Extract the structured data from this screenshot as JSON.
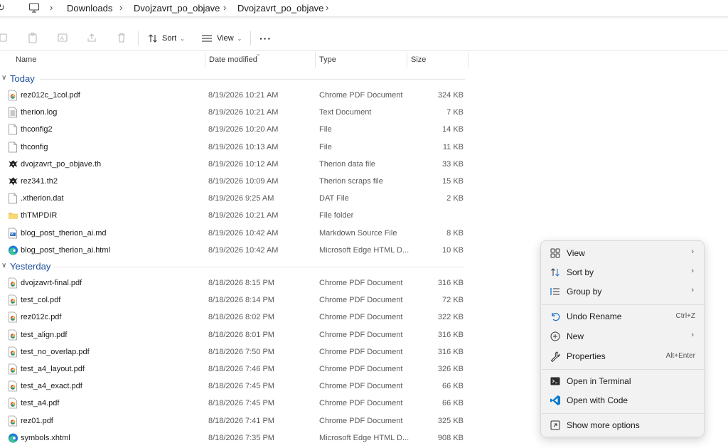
{
  "breadcrumb": {
    "items": [
      "Downloads",
      "Dvojzavrt_po_objave",
      "Dvojzavrt_po_objave"
    ]
  },
  "toolbar": {
    "sort_label": "Sort",
    "view_label": "View",
    "more_label": "···"
  },
  "columns": {
    "name": "Name",
    "date": "Date modified",
    "type": "Type",
    "size": "Size"
  },
  "groups": {
    "today": "Today",
    "yesterday": "Yesterday"
  },
  "today_files": [
    {
      "name": "rez012c_1col.pdf",
      "date": "8/19/2026 10:21 AM",
      "type": "Chrome PDF Document",
      "size": "324 KB",
      "icon": "pdf-icon"
    },
    {
      "name": "therion.log",
      "date": "8/19/2026 10:21 AM",
      "type": "Text Document",
      "size": "7 KB",
      "icon": "text-file-icon"
    },
    {
      "name": "thconfig2",
      "date": "8/19/2026 10:20 AM",
      "type": "File",
      "size": "14 KB",
      "icon": "file-icon"
    },
    {
      "name": "thconfig",
      "date": "8/19/2026 10:13 AM",
      "type": "File",
      "size": "11 KB",
      "icon": "file-icon"
    },
    {
      "name": "dvojzavrt_po_objave.th",
      "date": "8/19/2026 10:12 AM",
      "type": "Therion data file",
      "size": "33 KB",
      "icon": "therion-icon"
    },
    {
      "name": "rez341.th2",
      "date": "8/19/2026 10:09 AM",
      "type": "Therion scraps file",
      "size": "15 KB",
      "icon": "therion-icon"
    },
    {
      "name": ".xtherion.dat",
      "date": "8/19/2026 9:25 AM",
      "type": "DAT File",
      "size": "2 KB",
      "icon": "file-icon"
    },
    {
      "name": "thTMPDIR",
      "date": "8/19/2026 10:21 AM",
      "type": "File folder",
      "size": "",
      "icon": "folder-icon"
    },
    {
      "name": "blog_post_therion_ai.md",
      "date": "8/19/2026 10:42 AM",
      "type": "Markdown Source File",
      "size": "8 KB",
      "icon": "markdown-icon"
    },
    {
      "name": "blog_post_therion_ai.html",
      "date": "8/19/2026 10:42 AM",
      "type": "Microsoft Edge HTML D...",
      "size": "10 KB",
      "icon": "edge-icon"
    }
  ],
  "yesterday_files": [
    {
      "name": "dvojzavrt-final.pdf",
      "date": "8/18/2026 8:15 PM",
      "type": "Chrome PDF Document",
      "size": "316 KB",
      "icon": "pdf-icon"
    },
    {
      "name": "test_col.pdf",
      "date": "8/18/2026 8:14 PM",
      "type": "Chrome PDF Document",
      "size": "72 KB",
      "icon": "pdf-icon"
    },
    {
      "name": "rez012c.pdf",
      "date": "8/18/2026 8:02 PM",
      "type": "Chrome PDF Document",
      "size": "322 KB",
      "icon": "pdf-icon"
    },
    {
      "name": "test_align.pdf",
      "date": "8/18/2026 8:01 PM",
      "type": "Chrome PDF Document",
      "size": "316 KB",
      "icon": "pdf-icon"
    },
    {
      "name": "test_no_overlap.pdf",
      "date": "8/18/2026 7:50 PM",
      "type": "Chrome PDF Document",
      "size": "316 KB",
      "icon": "pdf-icon"
    },
    {
      "name": "test_a4_layout.pdf",
      "date": "8/18/2026 7:46 PM",
      "type": "Chrome PDF Document",
      "size": "326 KB",
      "icon": "pdf-icon"
    },
    {
      "name": "test_a4_exact.pdf",
      "date": "8/18/2026 7:45 PM",
      "type": "Chrome PDF Document",
      "size": "66 KB",
      "icon": "pdf-icon"
    },
    {
      "name": "test_a4.pdf",
      "date": "8/18/2026 7:45 PM",
      "type": "Chrome PDF Document",
      "size": "66 KB",
      "icon": "pdf-icon"
    },
    {
      "name": "rez01.pdf",
      "date": "8/18/2026 7:41 PM",
      "type": "Chrome PDF Document",
      "size": "325 KB",
      "icon": "pdf-icon"
    },
    {
      "name": "symbols.xhtml",
      "date": "8/18/2026 7:35 PM",
      "type": "Microsoft Edge HTML D...",
      "size": "908 KB",
      "icon": "edge-icon"
    }
  ],
  "context_menu": {
    "view": "View",
    "sort_by": "Sort by",
    "group_by": "Group by",
    "undo_rename": "Undo Rename",
    "undo_rename_key": "Ctrl+Z",
    "new": "New",
    "properties": "Properties",
    "properties_key": "Alt+Enter",
    "open_terminal": "Open in Terminal",
    "open_code": "Open with Code",
    "show_more": "Show more options"
  },
  "colors": {
    "group_label": "#1d4d9a",
    "menu_bg": "#f2f2f2",
    "pdf_red": "#db4437",
    "folder": "#f4c24e",
    "vscode_blue": "#0a7acc"
  }
}
